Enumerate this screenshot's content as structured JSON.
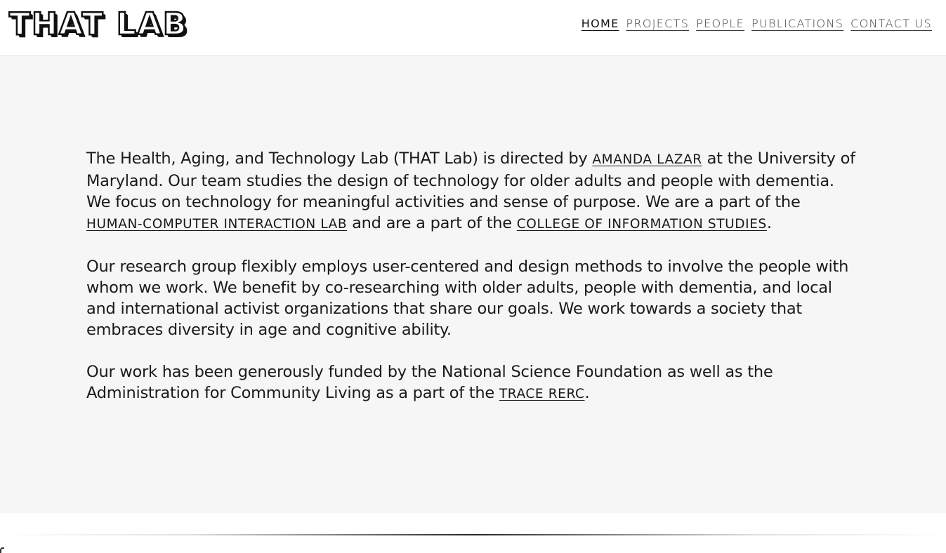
{
  "header": {
    "logo_text": "THAT LAB",
    "nav": [
      {
        "label": "HOME",
        "active": true
      },
      {
        "label": "PROJECTS",
        "active": false
      },
      {
        "label": "PEOPLE",
        "active": false
      },
      {
        "label": "PUBLICATIONS",
        "active": false
      },
      {
        "label": "CONTACT US",
        "active": false
      }
    ]
  },
  "main": {
    "p1": {
      "t1": "The Health, Aging, and Technology Lab (THAT Lab) is directed by ",
      "link1": "AMANDA LAZAR",
      "t2": " at the University of Maryland. Our team studies the design of technology for older adults and people with dementia. We focus on technology for meaningful activities and sense of purpose. We are a part of the ",
      "link2": "HUMAN-COMPUTER INTERACTION LAB",
      "t3": " and are a part of the ",
      "link3": "COLLEGE OF INFORMATION STUDIES",
      "t4": "."
    },
    "p2": "Our research group flexibly employs user-centered and design methods to involve the people with whom we work. We benefit by co-researching with older adults, people with dementia, and local and international activist organizations that share our goals. We work towards a society that embraces diversity in age and cognitive ability.",
    "p3": {
      "t1": "Our work has been generously funded by the National Science Foundation as well as the Administration for Community Living as a part of the ",
      "link1": "TRACE RERC",
      "t2": "."
    }
  },
  "colors": {
    "page_background": "#f6f6f6",
    "header_background": "#ffffff",
    "text": "#1a1a1a"
  }
}
